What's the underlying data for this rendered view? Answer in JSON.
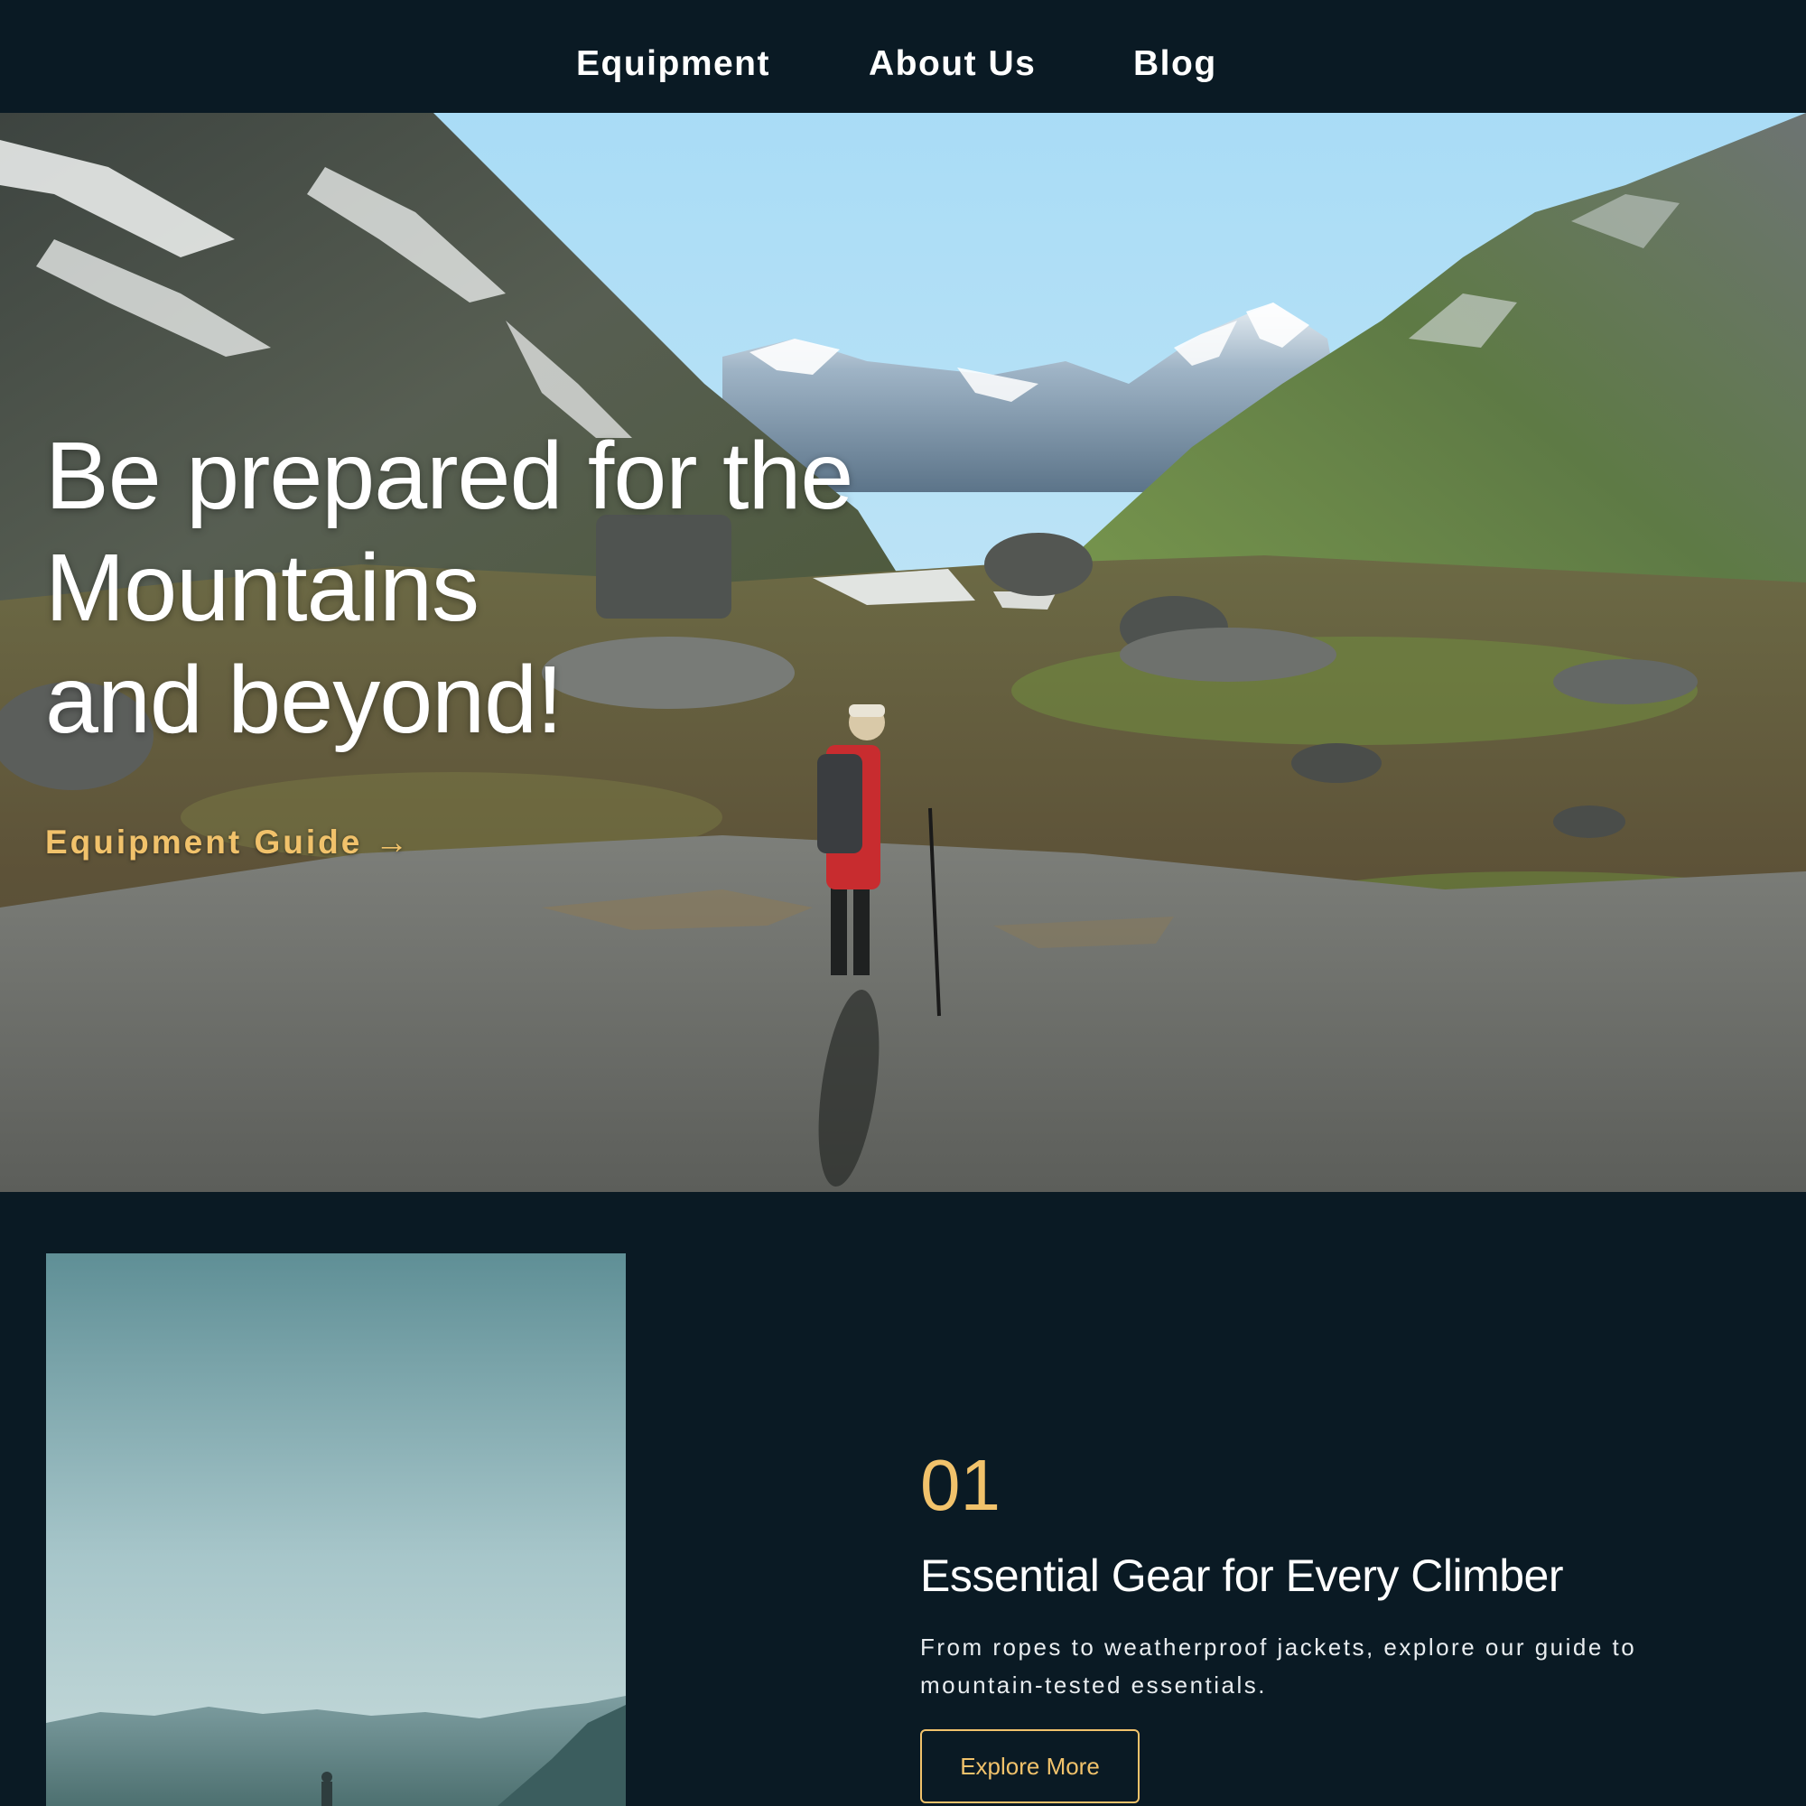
{
  "nav": {
    "links": [
      {
        "label": "Equipment"
      },
      {
        "label": "About Us"
      },
      {
        "label": "Blog"
      }
    ]
  },
  "hero": {
    "title_lines": [
      "Be prepared for the",
      "Mountains",
      "and beyond!"
    ],
    "cta_label": "Equipment Guide",
    "cta_icon": "arrow-right-icon",
    "cta_arrow": "→",
    "accent_color": "#f1c26b"
  },
  "feature": {
    "number": "01",
    "heading": "Essential Gear for Every Climber",
    "description": "From ropes to weatherproof jackets, explore our guide to mountain-tested essentials.",
    "button_label": "Explore More"
  },
  "colors": {
    "background": "#0a1a24",
    "accent": "#f1c26b",
    "text": "#ffffff"
  }
}
